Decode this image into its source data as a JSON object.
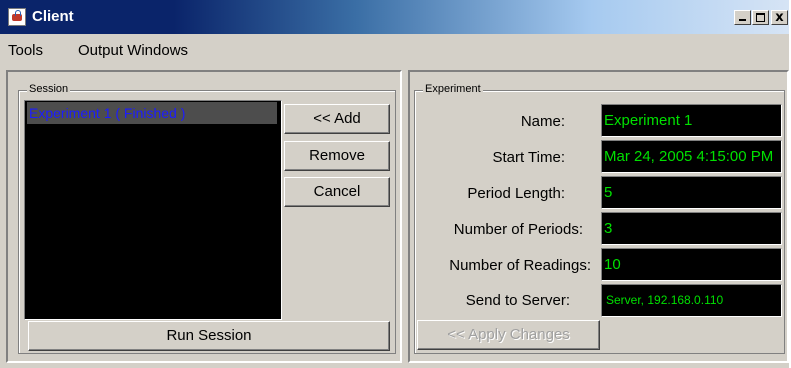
{
  "window": {
    "title": "Client",
    "min_label": "",
    "max_label": "",
    "close_label": "x"
  },
  "menu": {
    "items": [
      "Tools",
      "Output Windows"
    ]
  },
  "session": {
    "legend": "Session",
    "list": [
      {
        "label": "Experiment 1 ( Finished )",
        "selected": true
      }
    ],
    "add_label": "<< Add",
    "remove_label": "Remove",
    "cancel_label": "Cancel",
    "run_label": "Run Session"
  },
  "experiment": {
    "legend": "Experiment",
    "fields": [
      {
        "label": "Name:",
        "value": "Experiment 1"
      },
      {
        "label": "Start Time:",
        "value": "Mar 24, 2005 4:15:00 PM"
      },
      {
        "label": "Period Length:",
        "value": "5"
      },
      {
        "label": "Number of Periods:",
        "value": "3"
      },
      {
        "label": "Number of Readings:",
        "value": "10"
      },
      {
        "label": "Send to Server:",
        "value": "Server, 192.168.0.110"
      }
    ],
    "apply_label": "<< Apply Changes",
    "apply_enabled": false
  },
  "colors": {
    "titlebar": "#0a246a",
    "list_text": "#1c1cff",
    "field_text": "#00e000",
    "field_bg": "#000000",
    "face": "#d4d0c8"
  },
  "icons": {
    "window_icon": "java-app-icon"
  }
}
